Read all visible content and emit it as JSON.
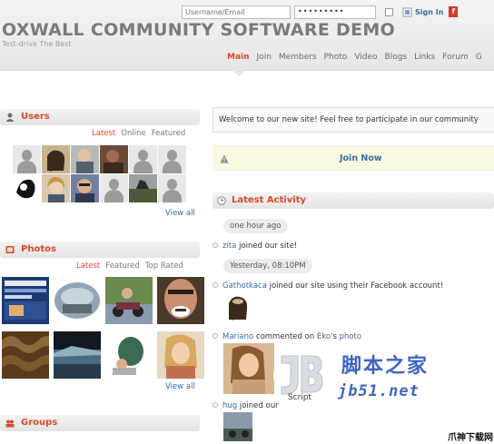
{
  "header": {
    "username_placeholder": "Username/Email",
    "password_value": "•••••••••",
    "signin_label": "Sign In",
    "site_title": "OXWALL COMMUNITY SOFTWARE DEMO",
    "tagline": "Test-drive The Best"
  },
  "nav": [
    "Main",
    "Join",
    "Members",
    "Photo",
    "Video",
    "Blogs",
    "Links",
    "Forum",
    "G"
  ],
  "users": {
    "title": "Users",
    "tabs": [
      "Latest",
      "Online",
      "Featured"
    ],
    "view_all": "View all"
  },
  "photos": {
    "title": "Photos",
    "tabs": [
      "Latest",
      "Featured",
      "Top Rated"
    ],
    "view_all": "View all"
  },
  "groups": {
    "title": "Groups"
  },
  "main": {
    "welcome": "Welcome to our new site! Feel free to participate in our community",
    "join_now": "Join Now",
    "activity_title": "Latest Activity",
    "time1": "one hour ago",
    "time2": "Yesterday, 08:10PM",
    "item1_user": "zita",
    "item1_text": " joined our site!",
    "item2_user": "Gathotkaca",
    "item2_text": " joined our site using their Facebook account!",
    "item3_user": "Mariano",
    "item3_mid": " commented on ",
    "item3_owner": "Eko",
    "item3_suffix": "'s ",
    "item3_link": "photo",
    "item4_user": "hug",
    "item4_text": " joined our"
  },
  "watermark": {
    "logo_text": "Script",
    "cn": "脚本之家",
    "url": "jb51.net",
    "corner": "爪神下载网"
  }
}
